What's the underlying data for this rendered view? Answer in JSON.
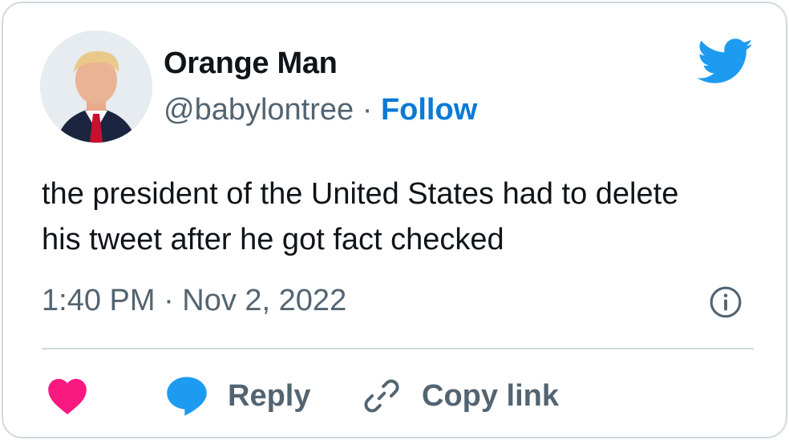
{
  "tweet": {
    "display_name": "Orange Man",
    "handle": "@babylontree",
    "separator": "·",
    "follow_label": "Follow",
    "text_line1": "the president of the United States had to delete",
    "text_line2": "his tweet after he got fact checked",
    "timestamp": "1:40 PM · Nov 2, 2022"
  },
  "actions": {
    "reply_label": "Reply",
    "copy_link_label": "Copy link"
  },
  "colors": {
    "brand": "#1d9bf0",
    "follow": "#0a7ad5",
    "heart": "#f91880",
    "muted": "#536471",
    "border": "#cfd9de"
  },
  "icons": {
    "brand": "twitter-bird-icon",
    "info": "info-icon",
    "like": "heart-icon",
    "reply": "speech-bubble-icon",
    "copy": "link-icon"
  }
}
